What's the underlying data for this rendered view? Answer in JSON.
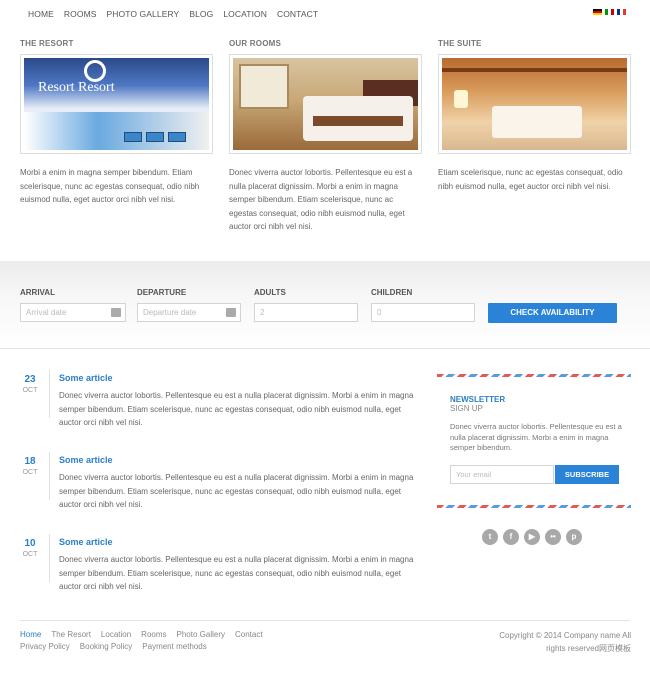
{
  "nav": {
    "items": [
      "HOME",
      "ROOMS",
      "PHOTO GALLERY",
      "BLOG",
      "LOCATION",
      "CONTACT"
    ]
  },
  "languages": [
    "german-flag",
    "italian-flag",
    "french-flag"
  ],
  "features": [
    {
      "title": "THE RESORT",
      "image_text": "Resort Resort",
      "text": "Morbi a enim in magna semper bibendum. Etiam scelerisque, nunc ac egestas consequat, odio nibh euismod nulla, eget auctor orci nibh vel nisi."
    },
    {
      "title": "OUR ROOMS",
      "text": "Donec viverra auctor lobortis. Pellentesque eu est a nulla placerat dignissim. Morbi a enim in magna semper bibendum. Etiam scelerisque, nunc ac egestas consequat, odio nibh euismod nulla, eget auctor orci nibh vel nisi."
    },
    {
      "title": "THE SUITE",
      "text": "Etiam scelerisque, nunc ac egestas consequat, odio nibh euismod nulla, eget auctor orci nibh vel nisi."
    }
  ],
  "booking": {
    "arrival_label": "ARRIVAL",
    "arrival_placeholder": "Arrival date",
    "departure_label": "DEPARTURE",
    "departure_placeholder": "Departure date",
    "adults_label": "ADULTS",
    "adults_value": "2",
    "children_label": "CHILDREN",
    "children_value": "0",
    "button": "CHECK AVAILABILITY"
  },
  "articles": [
    {
      "day": "23",
      "month": "OCT",
      "title": "Some article",
      "text": "Donec viverra auctor lobortis. Pellentesque eu est a nulla placerat dignissim. Morbi a enim in magna semper bibendum. Etiam scelerisque, nunc ac egestas consequat, odio nibh euismod nulla, eget auctor orci nibh vel nisi."
    },
    {
      "day": "18",
      "month": "OCT",
      "title": "Some article",
      "text": "Donec viverra auctor lobortis. Pellentesque eu est a nulla placerat dignissim. Morbi a enim in magna semper bibendum. Etiam scelerisque, nunc ac egestas consequat, odio nibh euismod nulla, eget auctor orci nibh vel nisi."
    },
    {
      "day": "10",
      "month": "OCT",
      "title": "Some article",
      "text": "Donec viverra auctor lobortis. Pellentesque eu est a nulla placerat dignissim. Morbi a enim in magna semper bibendum. Etiam scelerisque, nunc ac egestas consequat, odio nibh euismod nulla, eget auctor orci nibh vel nisi."
    }
  ],
  "newsletter": {
    "title": "NEWSLETTER",
    "subtitle": "SIGN UP",
    "text": "Donec viverra auctor lobortis. Pellentesque eu est a nulla placerat dignissim. Morbi a enim in magna semper bibendum.",
    "email_placeholder": "Your email",
    "button": "SUBSCRIBE"
  },
  "social": [
    {
      "icon": "twitter-icon",
      "glyph": "t"
    },
    {
      "icon": "facebook-icon",
      "glyph": "f"
    },
    {
      "icon": "youtube-icon",
      "glyph": "▶"
    },
    {
      "icon": "flickr-icon",
      "glyph": "••"
    },
    {
      "icon": "pinterest-icon",
      "glyph": "p"
    }
  ],
  "footer": {
    "nav": [
      "Home",
      "The Resort",
      "Location",
      "Rooms",
      "Photo Gallery",
      "Contact"
    ],
    "nav2": [
      "Privacy Policy",
      "Booking Policy",
      "Payment methods"
    ],
    "copyright": "Copyright © 2014 Company name All rights reserved网页模板"
  },
  "colors": {
    "accent": "#2a83d6",
    "link": "#2a7fc7"
  }
}
